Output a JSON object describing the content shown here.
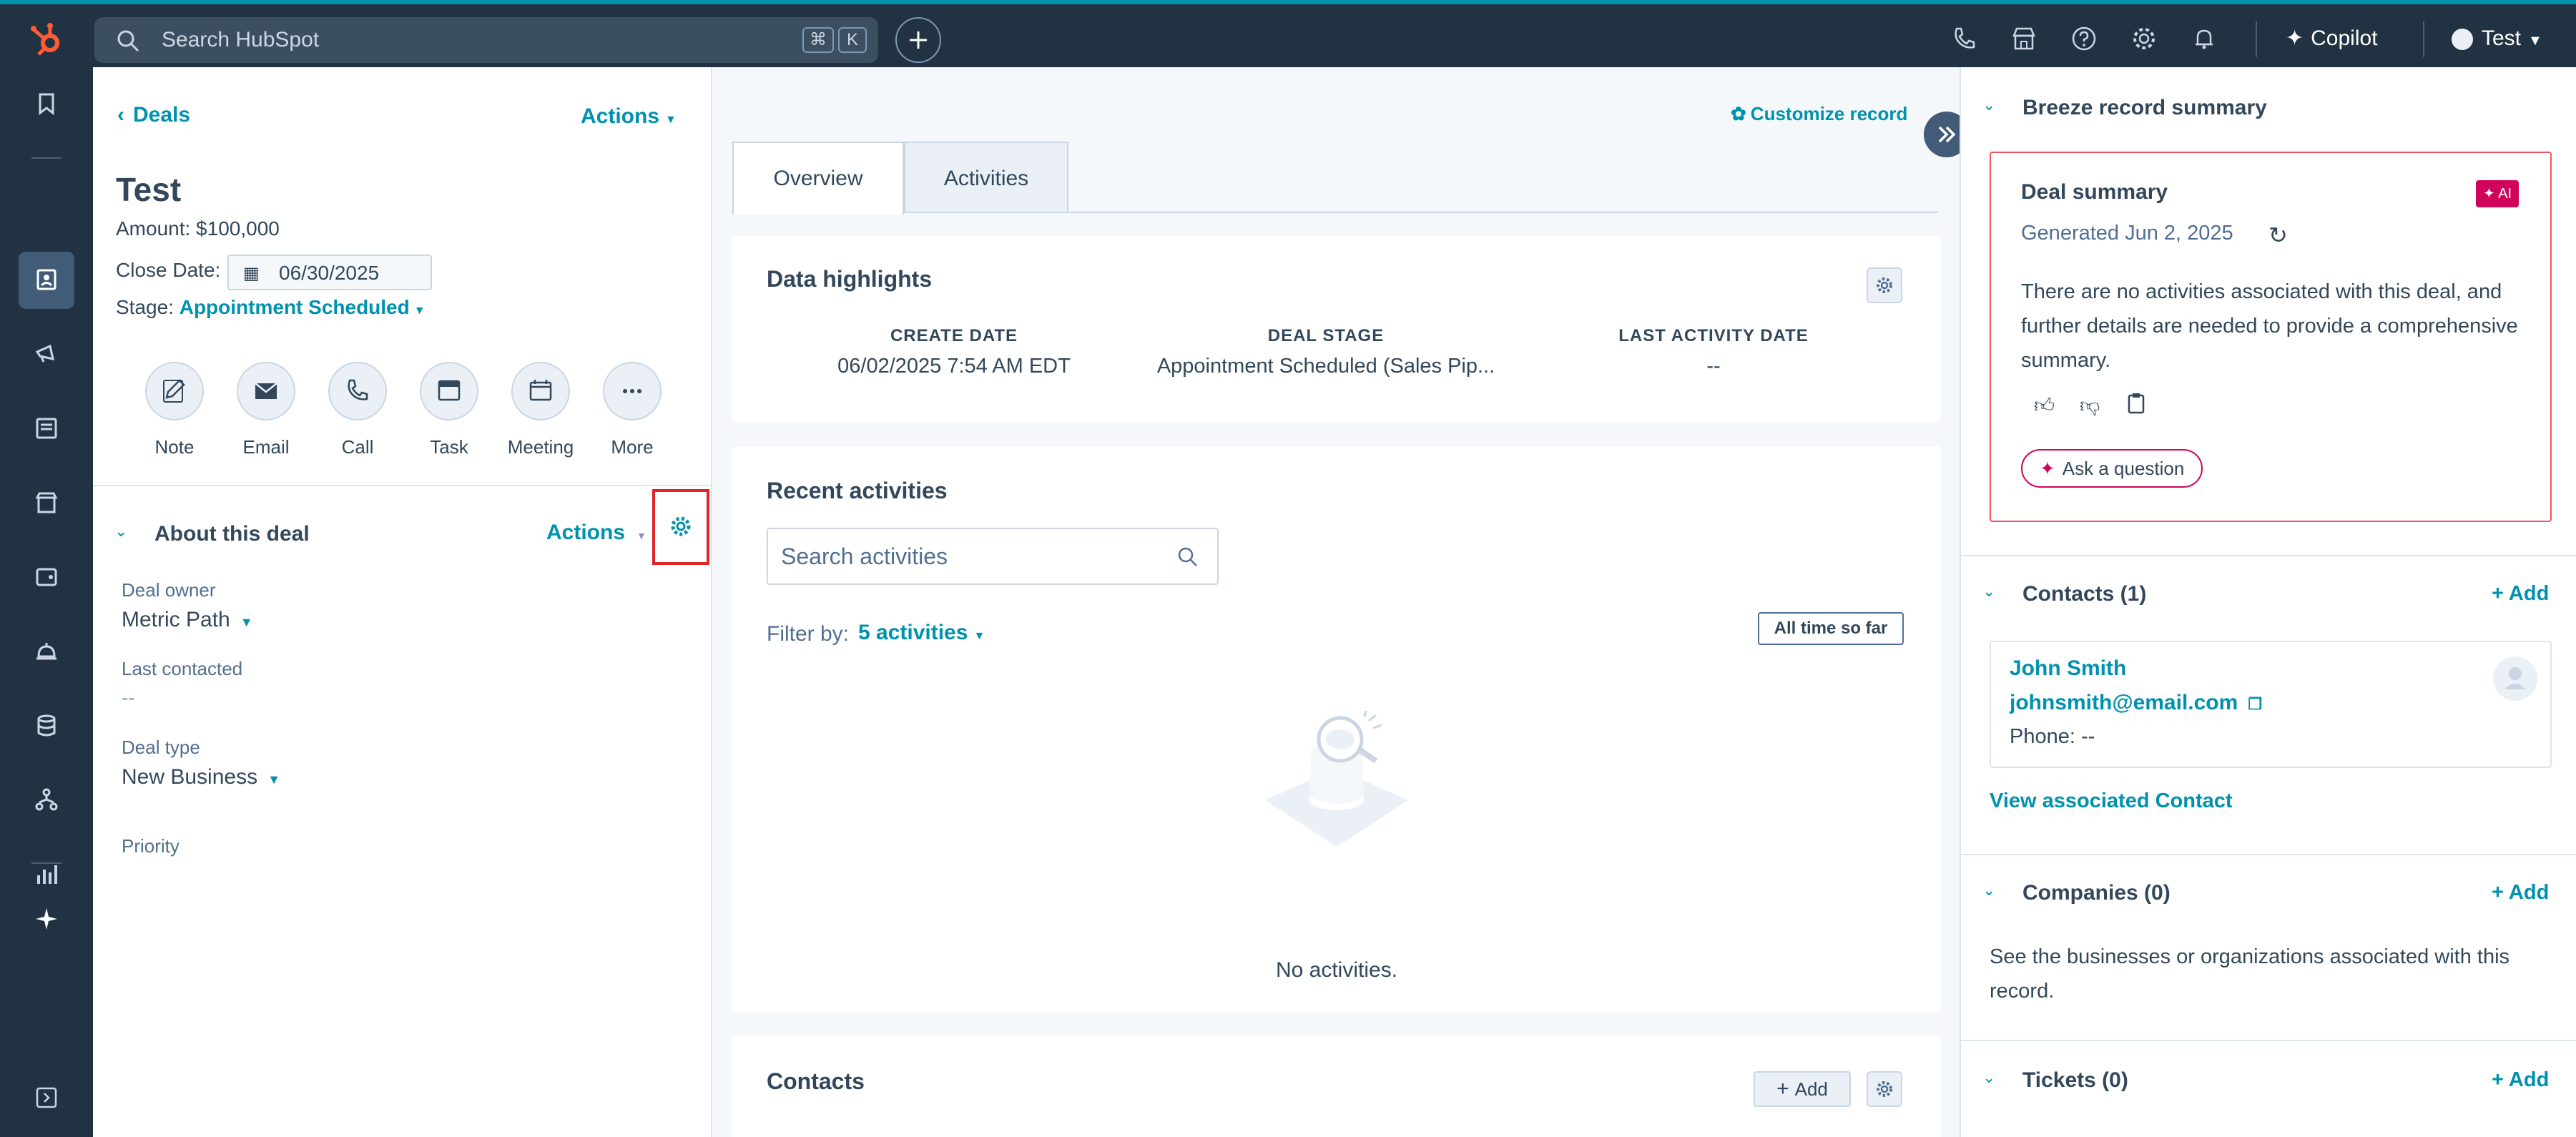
{
  "topbar": {
    "search_placeholder": "Search HubSpot",
    "kbd_cmd": "⌘",
    "kbd_k": "K",
    "copilot_label": "Copilot",
    "account_label": "Test"
  },
  "record": {
    "back_label": "Deals",
    "actions_label": "Actions",
    "title": "Test",
    "amount": "Amount: $100,000",
    "close_date_label": "Close Date:",
    "close_date_value": "06/30/2025",
    "stage_label": "Stage:",
    "stage_value": "Appointment Scheduled",
    "quick_actions": [
      "Note",
      "Email",
      "Call",
      "Task",
      "Meeting",
      "More"
    ]
  },
  "about": {
    "title": "About this deal",
    "actions_label": "Actions",
    "fields": [
      {
        "label": "Deal owner",
        "value": "Metric Path"
      },
      {
        "label": "Last contacted",
        "value": "--"
      },
      {
        "label": "Deal type",
        "value": "New Business"
      },
      {
        "label": "Priority",
        "value": ""
      }
    ]
  },
  "middle": {
    "customize_label": "Customize record",
    "tabs": [
      "Overview",
      "Activities"
    ],
    "highlights": {
      "title": "Data highlights",
      "columns": [
        {
          "label": "CREATE DATE",
          "value": "06/02/2025 7:54 AM EDT"
        },
        {
          "label": "DEAL STAGE",
          "value": "Appointment Scheduled (Sales Pip..."
        },
        {
          "label": "LAST ACTIVITY DATE",
          "value": "--"
        }
      ]
    },
    "recent": {
      "title": "Recent activities",
      "search_placeholder": "Search activities",
      "filter_label": "Filter by:",
      "filter_value": "5 activities",
      "time_filter": "All time so far",
      "empty_text": "No activities."
    },
    "contacts": {
      "title": "Contacts",
      "add_label": "Add"
    }
  },
  "right": {
    "breeze_title": "Breeze record summary",
    "summary": {
      "title": "Deal summary",
      "ai_badge": "✦ AI",
      "generated": "Generated Jun 2, 2025",
      "body": "There are no activities associated with this deal, and further details are needed to provide a comprehensive summary.",
      "ask_label": "Ask a question"
    },
    "contacts": {
      "title": "Contacts (1)",
      "add_label": "+ Add",
      "name": "John Smith",
      "email": "johnsmith@email.com",
      "phone": "Phone: --",
      "view_link": "View associated Contact"
    },
    "companies": {
      "title": "Companies (0)",
      "add_label": "+ Add",
      "description": "See the businesses or organizations associated with this record."
    },
    "tickets": {
      "title": "Tickets (0)",
      "add_label": "+ Add"
    }
  },
  "colors": {
    "nav_bg": "#213343",
    "accent": "#0091ae",
    "hubspot_orange": "#ff5c35",
    "highlight_box": "#e0242c",
    "ai_pink": "#d1045c"
  }
}
